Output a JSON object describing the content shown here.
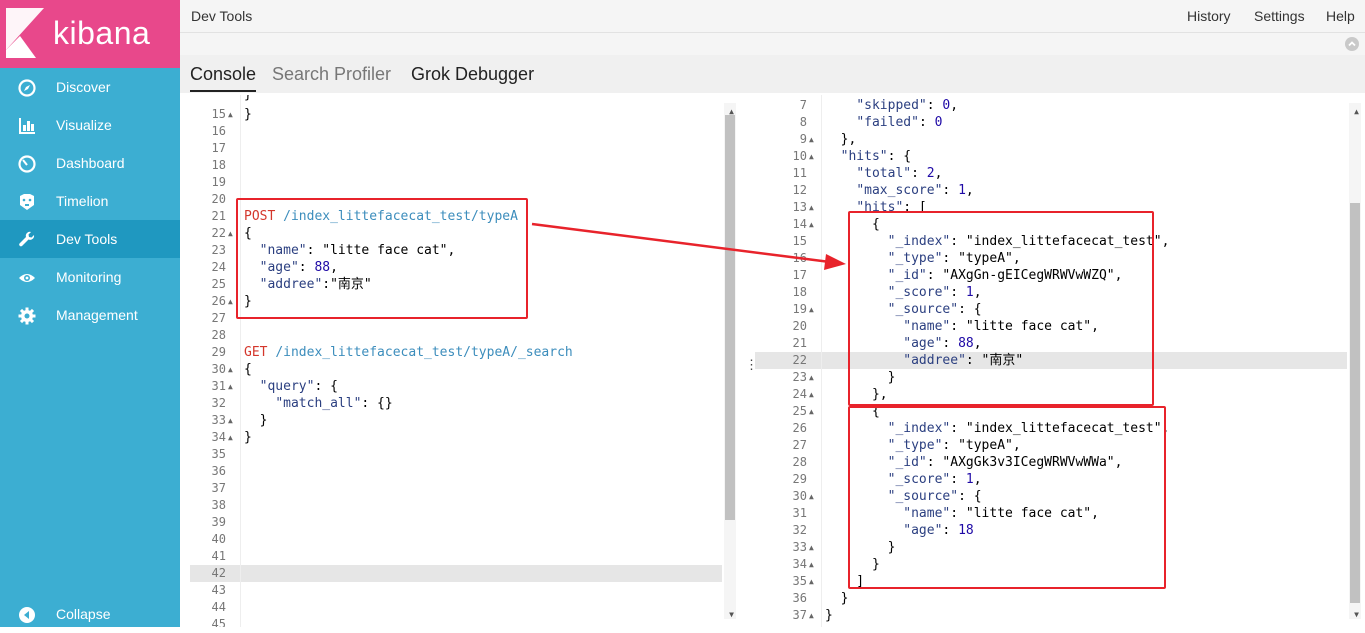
{
  "app": {
    "logo_text": "kibana"
  },
  "sidebar": {
    "items": [
      {
        "label": "Discover",
        "icon": "compass-icon"
      },
      {
        "label": "Visualize",
        "icon": "bar-chart-icon"
      },
      {
        "label": "Dashboard",
        "icon": "gauge-icon"
      },
      {
        "label": "Timelion",
        "icon": "timelion-icon"
      },
      {
        "label": "Dev Tools",
        "icon": "wrench-icon",
        "active": true
      },
      {
        "label": "Monitoring",
        "icon": "eye-icon"
      },
      {
        "label": "Management",
        "icon": "gear-icon"
      }
    ],
    "collapse_label": "Collapse"
  },
  "topbar": {
    "title": "Dev Tools",
    "history": "History",
    "settings": "Settings",
    "help": "Help"
  },
  "tabs": {
    "console": "Console",
    "search_profiler": "Search Profiler",
    "grok_debugger": "Grok Debugger"
  },
  "request_editor": {
    "lines": [
      {
        "n": "15",
        "fold": true,
        "text": "}"
      },
      {
        "n": "16",
        "text": ""
      },
      {
        "n": "17",
        "text": ""
      },
      {
        "n": "18",
        "text": ""
      },
      {
        "n": "19",
        "text": ""
      },
      {
        "n": "20",
        "text": ""
      },
      {
        "n": "21",
        "text": "POST /index_littefacecat_test/typeA"
      },
      {
        "n": "22",
        "fold": true,
        "text": "{"
      },
      {
        "n": "23",
        "text": "  \"name\": \"litte face cat\","
      },
      {
        "n": "24",
        "text": "  \"age\": 88,"
      },
      {
        "n": "25",
        "text": "  \"addree\":\"南京\""
      },
      {
        "n": "26",
        "fold": true,
        "text": "}"
      },
      {
        "n": "27",
        "text": ""
      },
      {
        "n": "28",
        "text": ""
      },
      {
        "n": "29",
        "text": "GET /index_littefacecat_test/typeA/_search"
      },
      {
        "n": "30",
        "fold": true,
        "text": "{"
      },
      {
        "n": "31",
        "fold": true,
        "text": "  \"query\": {"
      },
      {
        "n": "32",
        "text": "    \"match_all\": {}"
      },
      {
        "n": "33",
        "fold": true,
        "text": "  }"
      },
      {
        "n": "34",
        "fold": true,
        "text": "}"
      },
      {
        "n": "35",
        "text": ""
      },
      {
        "n": "36",
        "text": ""
      },
      {
        "n": "37",
        "text": ""
      },
      {
        "n": "38",
        "text": ""
      },
      {
        "n": "39",
        "text": ""
      },
      {
        "n": "40",
        "text": ""
      },
      {
        "n": "41",
        "text": ""
      },
      {
        "n": "42",
        "text": ""
      },
      {
        "n": "43",
        "text": ""
      },
      {
        "n": "44",
        "text": ""
      },
      {
        "n": "45",
        "text": ""
      }
    ],
    "active_line": "42"
  },
  "response_editor": {
    "lines": [
      {
        "n": "7",
        "text": "    \"skipped\": 0,"
      },
      {
        "n": "8",
        "text": "    \"failed\": 0"
      },
      {
        "n": "9",
        "fold": true,
        "text": "  },"
      },
      {
        "n": "10",
        "fold": true,
        "text": "  \"hits\": {"
      },
      {
        "n": "11",
        "text": "    \"total\": 2,"
      },
      {
        "n": "12",
        "text": "    \"max_score\": 1,"
      },
      {
        "n": "13",
        "fold": true,
        "text": "    \"hits\": ["
      },
      {
        "n": "14",
        "fold": true,
        "text": "      {"
      },
      {
        "n": "15",
        "text": "        \"_index\": \"index_littefacecat_test\","
      },
      {
        "n": "16",
        "text": "        \"_type\": \"typeA\","
      },
      {
        "n": "17",
        "text": "        \"_id\": \"AXgGn-gEICegWRWVwWZQ\","
      },
      {
        "n": "18",
        "text": "        \"_score\": 1,"
      },
      {
        "n": "19",
        "fold": true,
        "text": "        \"_source\": {"
      },
      {
        "n": "20",
        "text": "          \"name\": \"litte face cat\","
      },
      {
        "n": "21",
        "text": "          \"age\": 88,"
      },
      {
        "n": "22",
        "text": "          \"addree\": \"南京\""
      },
      {
        "n": "23",
        "fold": true,
        "text": "        }"
      },
      {
        "n": "24",
        "fold": true,
        "text": "      },"
      },
      {
        "n": "25",
        "fold": true,
        "text": "      {"
      },
      {
        "n": "26",
        "text": "        \"_index\": \"index_littefacecat_test\","
      },
      {
        "n": "27",
        "text": "        \"_type\": \"typeA\","
      },
      {
        "n": "28",
        "text": "        \"_id\": \"AXgGk3v3ICegWRWVwWWa\","
      },
      {
        "n": "29",
        "text": "        \"_score\": 1,"
      },
      {
        "n": "30",
        "fold": true,
        "text": "        \"_source\": {"
      },
      {
        "n": "31",
        "text": "          \"name\": \"litte face cat\","
      },
      {
        "n": "32",
        "text": "          \"age\": 18"
      },
      {
        "n": "33",
        "fold": true,
        "text": "        }"
      },
      {
        "n": "34",
        "fold": true,
        "text": "      }"
      },
      {
        "n": "35",
        "fold": true,
        "text": "    ]"
      },
      {
        "n": "36",
        "text": "  }"
      },
      {
        "n": "37",
        "fold": true,
        "text": "}"
      }
    ],
    "active_line": "22"
  },
  "colors": {
    "sidebar": "#3caed2",
    "logo_bg": "#e8488b",
    "annotation": "#e8232b"
  }
}
